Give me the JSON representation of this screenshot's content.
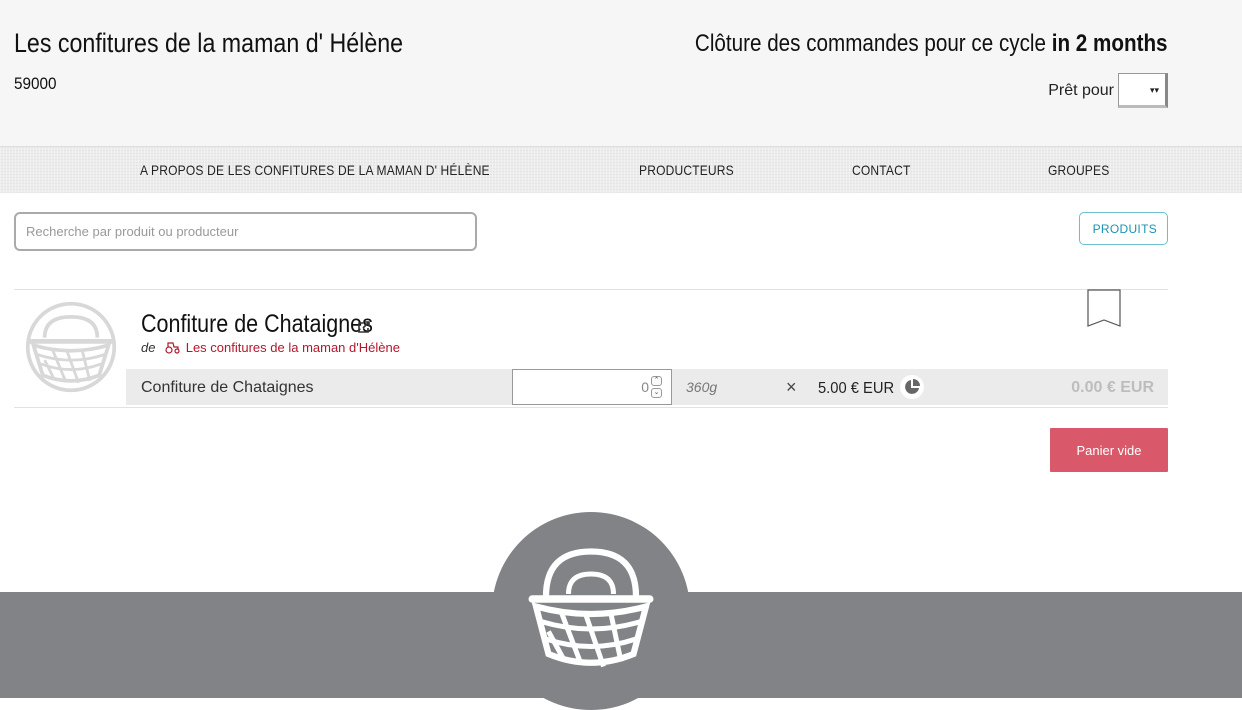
{
  "header": {
    "shop_name": "Les confitures de la maman d' Hélène",
    "zip": "59000",
    "closing_prefix": "Clôture des commandes pour ce cycle",
    "closing_time": "in 2 months",
    "ready_label": "Prêt pour",
    "ready_value": ""
  },
  "nav": {
    "items": [
      {
        "label": "A PROPOS DE LES CONFITURES DE LA MAMAN D' HÉLÈNE"
      },
      {
        "label": "PRODUCTEURS"
      },
      {
        "label": "CONTACT"
      },
      {
        "label": "GROUPES"
      }
    ]
  },
  "search": {
    "placeholder": "Recherche par produit ou producteur",
    "value": ""
  },
  "products_button": "PRODUITS",
  "product": {
    "name": "Confiture de Chataignes",
    "by_label": "de",
    "producer": "Les confitures de la maman d'Hélène",
    "variant": {
      "name": "Confiture de Chataignes",
      "quantity": "0",
      "unit": "360g",
      "times": "×",
      "price": "5.00 € EUR",
      "total": "0.00 € EUR"
    }
  },
  "cart_button": "Panier vide",
  "icons": {
    "basket": "basket-icon",
    "external_link": "external-link-icon",
    "tractor": "tractor-icon",
    "bookmark": "bookmark-icon",
    "pie": "pie-chart-icon",
    "spinner_up": "chevron-up-icon",
    "spinner_down": "chevron-down-icon"
  },
  "colors": {
    "accent_red": "#d9596a",
    "producer_red": "#b3172e",
    "link_blue": "#1b93b3",
    "footer_gray": "#828387"
  }
}
